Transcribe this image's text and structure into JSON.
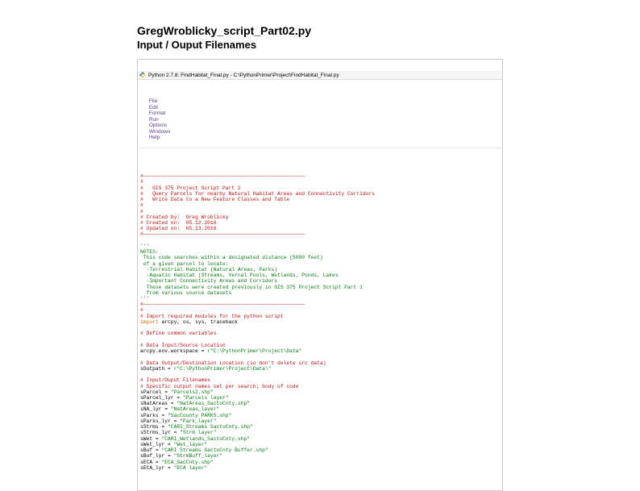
{
  "heading1": "GregWroblicky_script_Part02.py",
  "heading2": "Input / Ouput Filenames",
  "window": {
    "title": "Python 2.7.8: FindHabitat_Final.py - C:\\PythonPrimer\\Project\\FindHabitat_Final.py"
  },
  "menubar": [
    "File",
    "Edit",
    "Format",
    "Run",
    "Options",
    "Windows",
    "Help"
  ],
  "icons": {
    "python": "python-icon"
  },
  "code": {
    "hr": "#─────────────────────────────────────────────────────",
    "h1": "#",
    "h2": "#   GIS 375 Project Script Part 2",
    "h3": "#   Query Parcels for nearby Natural Habitat Areas and Connectivity Corridors",
    "h4": "#   Write Data to a New Feature Classes and Table",
    "h5": "#",
    "h6": "#",
    "h7": "# Created by:  Greg Wroblicky",
    "h8": "# Created on:  05.12.2016",
    "h9": "# Updated on:  05.13.2016",
    "tq": "'''",
    "n1": "NOTES:",
    "n2": " This code searches within a designated distance (5000 feet)",
    "n3": " of a given parcel to locate:",
    "n4": "  -Terrestrial Habitat (Natural Areas, Parks)",
    "n5": "  -Aquatic Habitat (Streams, Vernal Pools, Wetlands, Ponds, Lakes",
    "n6": "  -Important Connectivity Areas and Corridors",
    "n7": "  These datasets were created previously in GIS 375 Project Script Part 1",
    "n8": "  from various source datasets",
    "c1": "# Import required modules for the python script",
    "imp_kw": "import",
    "imp_rest": " arcpy, os, sys, traceback",
    "c2": "# Define common variables",
    "c3": "# Data Input/Source Location",
    "ws1a": "arcpy.env.workspace = ",
    "ws1b": "r\"C:\\PythonPrimer\\Project\\Data\"",
    "c4": "# Data Output/Destination Location (so don't delete src data)",
    "ws2a": "sOutpath = ",
    "ws2b": "r\"C:\\PythonPrimer\\Project\\Data\\\"",
    "c5": "# Input/Ouput Filenames",
    "c6": "# Specific output names set per search; body of code",
    "v1a": "sParcel = ",
    "v1b": "\"Parcels2.shp\"",
    "v2a": "sParcel_lyr = ",
    "v2b": "\"Parcels layer\"",
    "v3a": "sNatAreas = ",
    "v3b": "\"NatAreas_SactoCnty.shp\"",
    "v4a": "sNA_lyr = ",
    "v4b": "\"NatAreas_layer\"",
    "v5a": "sParks = ",
    "v5b": "\"SacCounty PARKS.shp\"",
    "v6a": "sParks_lyr = ",
    "v6b": "\"Park_layer\"",
    "v7a": "sStrms = ",
    "v7b": "\"CARI_Streams SactoCnty.shp\"",
    "v8a": "sStrms_lyr = ",
    "v8b": "\"Strm layer\"",
    "v9a": "sWet = ",
    "v9b": "\"CARI_Wetlands_SactoCnty.shp\"",
    "v10a": "sWet_lyr = ",
    "v10b": "\"Wet_layer\"",
    "v11a": "sBuf = ",
    "v11b": "\"CARI Streams SactoCnty Buffer.shp\"",
    "v12a": "sBuf_lyr = ",
    "v12b": "\"StrmBuff_layer\"",
    "v13a": "sECA = ",
    "v13b": "\"ECA_SacCnty.shp\"",
    "v14a": "sECA_lyr = ",
    "v14b": "\"ECA layer\""
  }
}
